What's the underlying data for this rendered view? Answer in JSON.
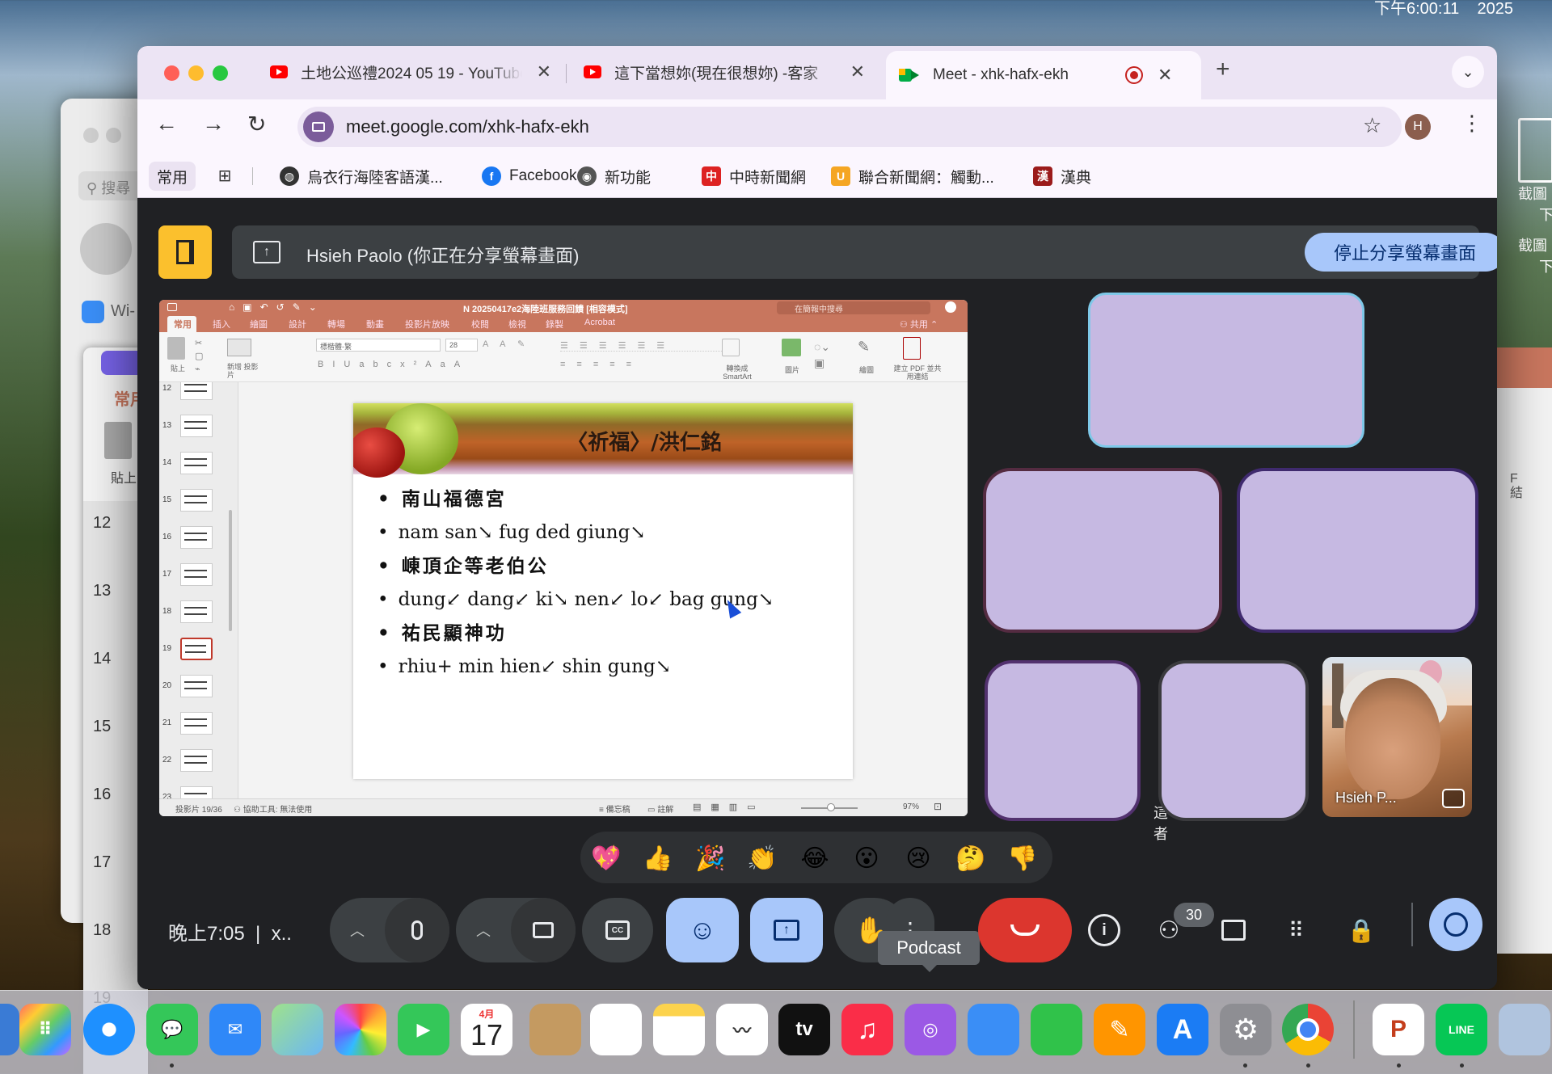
{
  "menubar": {
    "clock": "下午6:00:11",
    "year": "2025"
  },
  "desktop": {
    "right_items": [
      "截圖",
      "下",
      "截圖",
      "下"
    ]
  },
  "bg_windows": {
    "search_placeholder": "搜尋",
    "wifi_label": "Wi-",
    "tab_label": "常用",
    "paste_label": "貼上",
    "slide_numbers": [
      "12",
      "13",
      "14",
      "15",
      "16",
      "17",
      "18",
      "19"
    ],
    "right_text": "F 結"
  },
  "browser": {
    "tabs": [
      {
        "title": "土地公巡禮2024 05 19 - YouTube"
      },
      {
        "title": "這下當想妳(現在很想妳) -客家"
      },
      {
        "title": "Meet - xhk-hafx-ekh"
      }
    ],
    "new_tab": "+",
    "url": "meet.google.com/xhk-hafx-ekh",
    "profile_initial": "H",
    "bookmarks": [
      {
        "label": "常用"
      },
      {
        "label": "烏衣行海陸客語漢..."
      },
      {
        "label": "Facebook"
      },
      {
        "label": "新功能"
      },
      {
        "label": "中時新聞網"
      },
      {
        "label": "聯合新聞網：觸動..."
      },
      {
        "label": "漢典"
      }
    ]
  },
  "meet": {
    "share_text": "Hsieh Paolo (你正在分享螢幕畫面)",
    "stop_share_label": "停止分享螢幕畫面",
    "video_name": "Hsieh P...",
    "tile_5_text": "這 者",
    "clock": "晚上7:05",
    "meeting_code_short": "x..",
    "tooltip": "Podcast",
    "participant_count": "30",
    "reactions": [
      "💖",
      "👍",
      "🎉",
      "👏",
      "😂",
      "😮",
      "😢",
      "🤔",
      "👎"
    ]
  },
  "ppt": {
    "doc_title": "N 20250417e2海陸班服務回饋 [相容模式]",
    "search_placeholder": "在簡報中搜尋",
    "share": "共用",
    "tabs": [
      "常用",
      "插入",
      "繪圖",
      "設計",
      "轉場",
      "動畫",
      "投影片放映",
      "校閱",
      "檢視",
      "錄製",
      "Acrobat"
    ],
    "ribbon": {
      "paste": "貼上",
      "new_slide": "新增 投影片",
      "font": "標楷體-繁",
      "size": "28",
      "smartart": "轉換成 SmartArt",
      "picture": "圖片",
      "draw": "繪圖",
      "pdf": "建立 PDF 並共用連結"
    },
    "thumb_numbers": [
      "12",
      "13",
      "14",
      "15",
      "16",
      "17",
      "18",
      "19",
      "20",
      "21",
      "22",
      "23"
    ],
    "status_left": "投影片 19/36",
    "status_access": "協助工具: 無法使用",
    "status_notes": "備忘稿",
    "status_comments": "註解",
    "zoom": "97%",
    "slide": {
      "title": "〈祈福〉/洪仁銘",
      "lines": [
        "南山福德宮",
        "nam san↘ fug ded giung↘",
        "崠頂企等老伯公",
        "dung↙ dang↙ ki↘ nen↙ lo↙ bag gung↘",
        "祐民顯神功",
        "rhiu+ min hien↙ shin gung↘"
      ]
    }
  },
  "dock": {
    "calendar_month": "4月",
    "calendar_day": "17",
    "tv_label": "tv",
    "line_label": "LINE",
    "ppt_letter": "P",
    "apps": [
      "launchpad",
      "safari",
      "messages",
      "mail",
      "maps",
      "photos",
      "facetime",
      "calendar",
      "contacts",
      "reminders",
      "notes",
      "freeform",
      "tv",
      "music",
      "podcasts",
      "keynote",
      "numbers",
      "pages",
      "app-store",
      "system-settings",
      "chrome",
      "powerpoint",
      "line",
      "preview"
    ]
  }
}
